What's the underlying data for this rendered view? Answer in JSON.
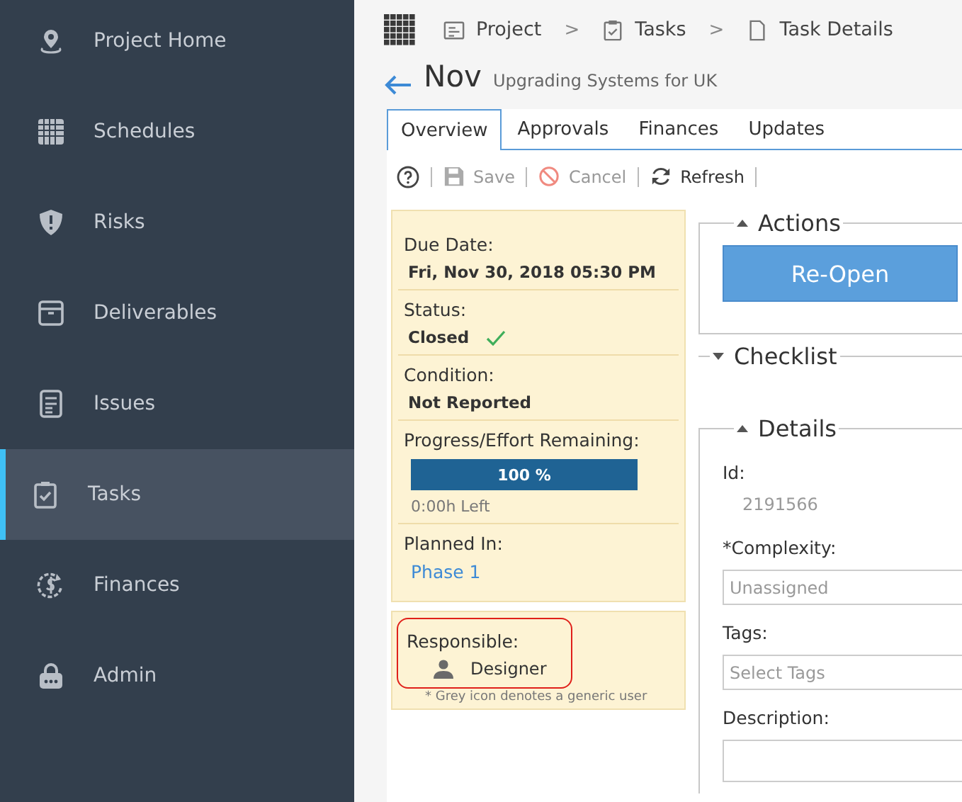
{
  "sidebar": {
    "items": [
      {
        "label": "Project Home",
        "kind": "pin",
        "selected": false
      },
      {
        "label": "Schedules",
        "kind": "grid",
        "selected": false
      },
      {
        "label": "Risks",
        "kind": "shield",
        "selected": false
      },
      {
        "label": "Deliverables",
        "kind": "box",
        "selected": false
      },
      {
        "label": "Issues",
        "kind": "doc",
        "selected": false
      },
      {
        "label": "Tasks",
        "kind": "clipboard",
        "selected": true
      },
      {
        "label": "Finances",
        "kind": "money",
        "selected": false
      },
      {
        "label": "Admin",
        "kind": "lock",
        "selected": false
      }
    ]
  },
  "breadcrumb": [
    {
      "label": "Project",
      "kind": "project"
    },
    {
      "label": "Tasks",
      "kind": "clipboard"
    },
    {
      "label": "Task Details",
      "kind": "page"
    }
  ],
  "breadcrumb_separator": ">",
  "header": {
    "title": "Nov",
    "subtitle": "Upgrading Systems for UK"
  },
  "tabs": [
    {
      "label": "Overview",
      "selected": true
    },
    {
      "label": "Approvals",
      "selected": false
    },
    {
      "label": "Finances",
      "selected": false
    },
    {
      "label": "Updates",
      "selected": false
    }
  ],
  "toolbar": [
    {
      "kind": "help"
    },
    {
      "kind": "save",
      "label": "Save",
      "disabled": true
    },
    {
      "kind": "cancel",
      "label": "Cancel",
      "disabled": true
    },
    {
      "kind": "refresh",
      "label": "Refresh",
      "disabled": false
    }
  ],
  "summary": {
    "due_date": {
      "label": "Due Date:",
      "value": "Fri, Nov 30, 2018 05:30 PM"
    },
    "status": {
      "label": "Status:",
      "value": "Closed",
      "done": true
    },
    "condition": {
      "label": "Condition:",
      "value": "Not Reported"
    },
    "progress": {
      "label": "Progress/Effort Remaining:",
      "level": 1,
      "reading": "100 %",
      "remaining": "0:00h Left"
    },
    "planned_in": {
      "label": "Planned In:",
      "value": "Phase 1"
    }
  },
  "responsible": {
    "label": "Responsible:",
    "name": "Designer",
    "highlighted": true,
    "note": "* Grey icon denotes a generic user"
  },
  "sections": {
    "actions": {
      "title": "Actions",
      "expanded": true,
      "button": "Re-Open"
    },
    "checklist": {
      "title": "Checklist",
      "expanded": false
    },
    "details": {
      "title": "Details",
      "expanded": true,
      "id_label": "Id:",
      "id_value": "2191566",
      "complexity_label": "*Complexity:",
      "complexity_value": "Unassigned",
      "tags_label": "Tags:",
      "tags_placeholder": "Select Tags",
      "description_label": "Description:"
    }
  }
}
